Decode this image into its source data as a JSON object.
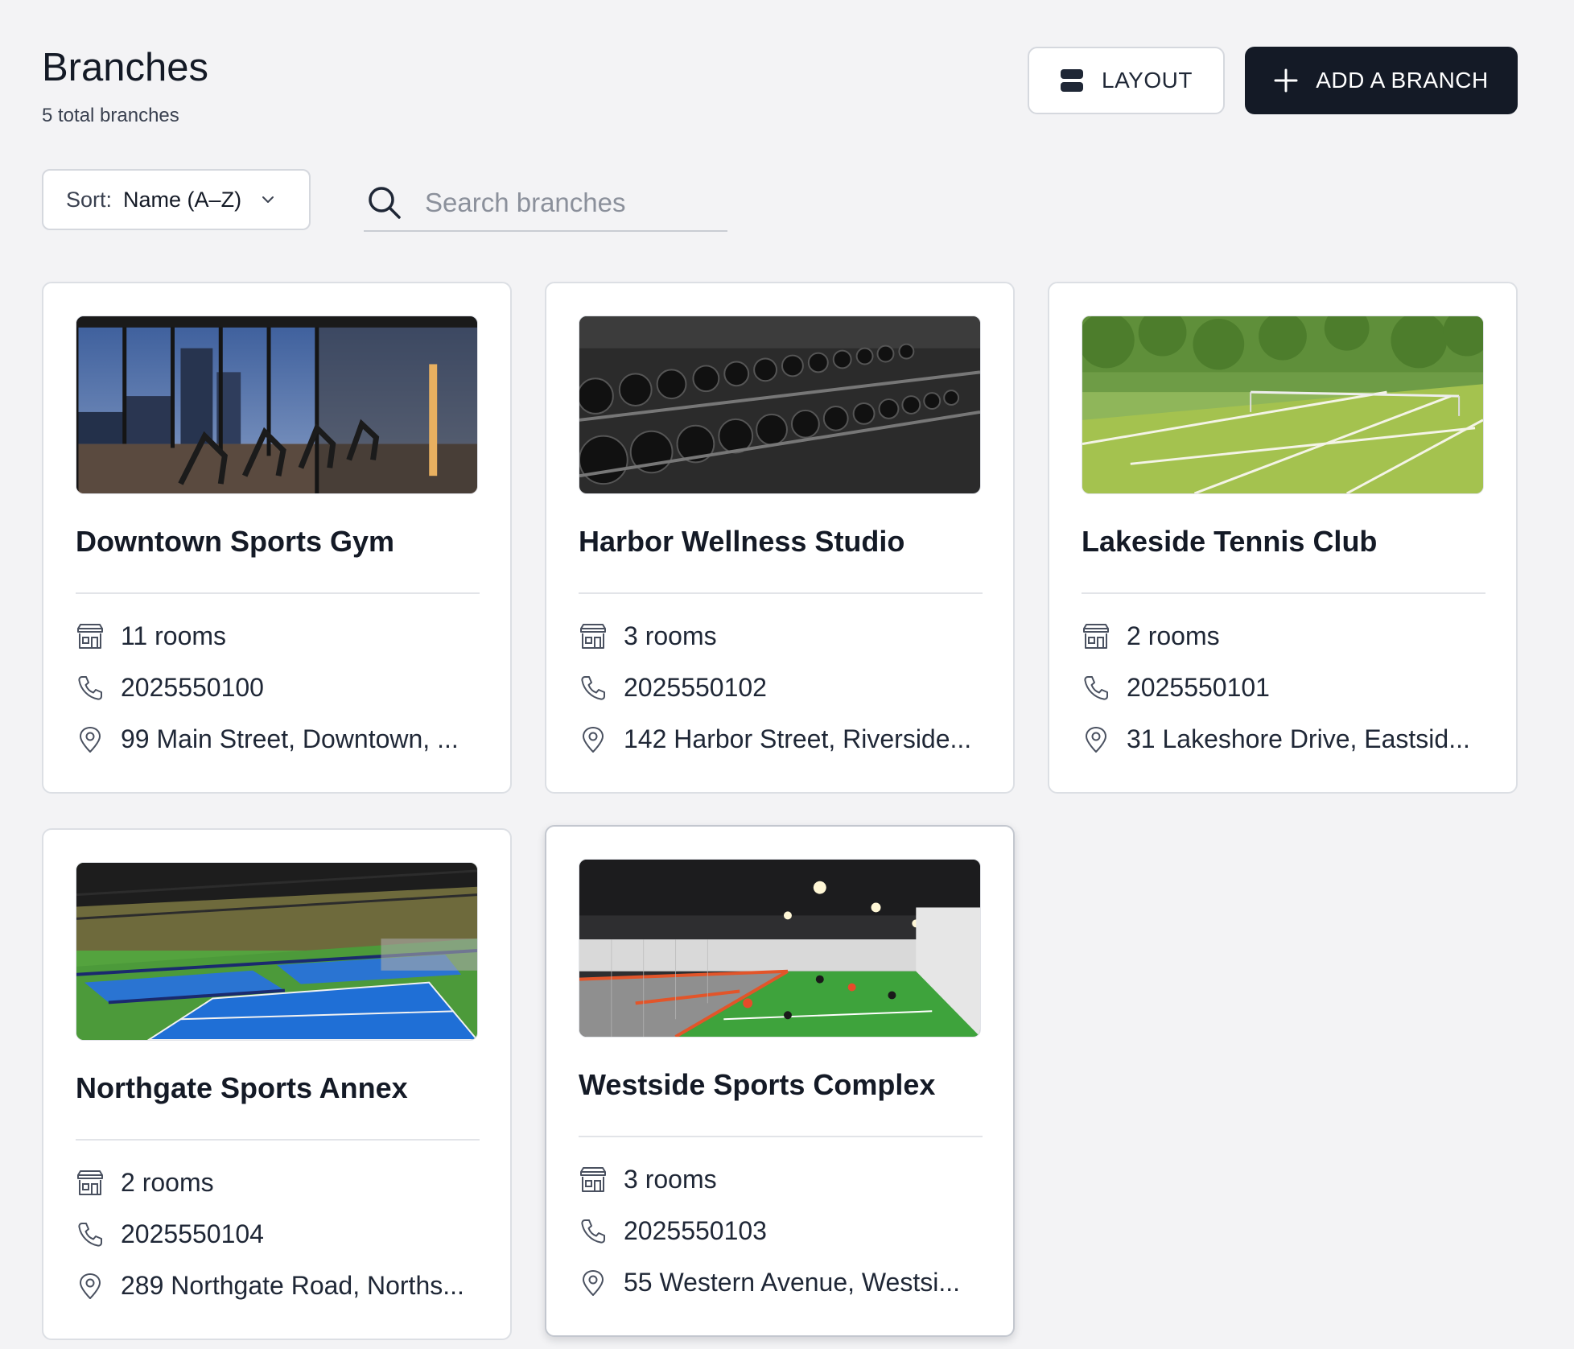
{
  "header": {
    "title": "Branches",
    "subtitle": "5 total branches",
    "layout_label": "LAYOUT",
    "add_label": "ADD A BRANCH"
  },
  "toolbar": {
    "sort_label": "Sort:",
    "sort_value": "Name (A–Z)",
    "search_placeholder": "Search branches"
  },
  "branches": [
    {
      "name": "Downtown Sports Gym",
      "rooms": "11 rooms",
      "phone": "2025550100",
      "address": "99 Main Street, Downtown, ..."
    },
    {
      "name": "Harbor Wellness Studio",
      "rooms": "3 rooms",
      "phone": "2025550102",
      "address": "142 Harbor Street, Riverside..."
    },
    {
      "name": "Lakeside Tennis Club",
      "rooms": "2 rooms",
      "phone": "2025550101",
      "address": "31 Lakeshore Drive, Eastsid..."
    },
    {
      "name": "Northgate Sports Annex",
      "rooms": "2 rooms",
      "phone": "2025550104",
      "address": "289 Northgate Road, Norths..."
    },
    {
      "name": "Westside Sports Complex",
      "rooms": "3 rooms",
      "phone": "2025550103",
      "address": "55 Western Avenue, Westsi..."
    }
  ],
  "icons": {
    "layout": "layout-rows-icon",
    "add": "plus-icon",
    "sort": "chevron-down-icon",
    "search": "search-icon",
    "rooms": "building-icon",
    "phone": "phone-icon",
    "address": "map-pin-icon"
  },
  "colors": {
    "background": "#f3f3f5",
    "primary_button": "#141a26",
    "card": "#ffffff",
    "border": "#dcdfe4"
  }
}
